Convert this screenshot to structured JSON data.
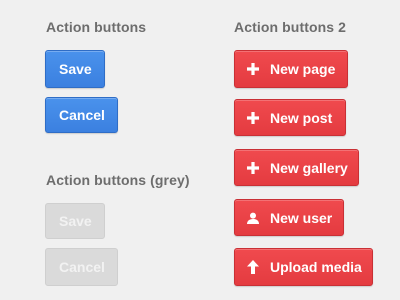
{
  "left": {
    "heading": "Action buttons",
    "blue_buttons": {
      "save": "Save",
      "cancel": "Cancel"
    },
    "grey_heading": "Action buttons (grey)",
    "grey_buttons": {
      "save": "Save",
      "cancel": "Cancel"
    }
  },
  "right": {
    "heading": "Action buttons 2",
    "buttons": [
      {
        "label": "New page",
        "icon": "plus-icon"
      },
      {
        "label": "New post",
        "icon": "plus-icon"
      },
      {
        "label": "New gallery",
        "icon": "plus-icon"
      },
      {
        "label": "New user",
        "icon": "user-icon"
      },
      {
        "label": "Upload media",
        "icon": "upload-arrow-icon"
      }
    ]
  },
  "colors": {
    "background": "#f0f0f0",
    "blue": "#3f86e6",
    "red": "#e8434a",
    "grey": "#dadada",
    "heading": "#6d6d6d"
  }
}
